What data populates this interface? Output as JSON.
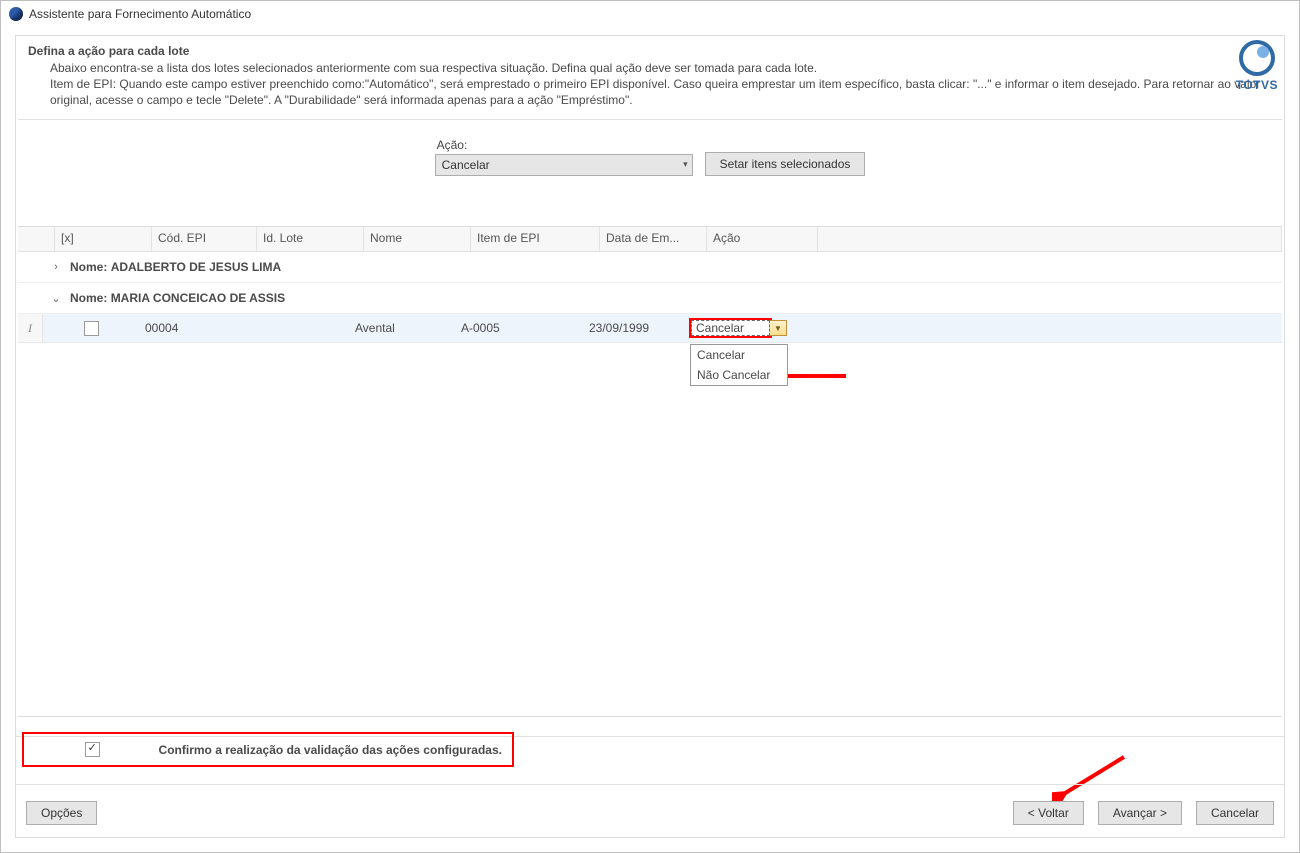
{
  "window": {
    "title": "Assistente para Fornecimento Automático"
  },
  "brand": {
    "name": "TOTVS"
  },
  "page": {
    "title": "Defina a ação para cada lote",
    "desc_line1": "Abaixo encontra-se a lista dos lotes selecionados anteriormente com sua respectiva situação. Defina qual ação deve ser tomada para cada lote.",
    "desc_line2": "Item de EPI: Quando este campo estiver preenchido como:\"Automático\", será emprestado o primeiro EPI disponível. Caso queira emprestar um item específico, basta clicar: \"...\" e informar o item desejado. Para retornar ao valor original, acesse o campo e tecle \"Delete\". A \"Durabilidade\" será informada apenas para a ação \"Empréstimo\"."
  },
  "controls": {
    "action_label": "Ação:",
    "action_value": "Cancelar",
    "set_btn": "Setar itens selecionados"
  },
  "grid": {
    "columns": {
      "chk": "[x]",
      "cod": "Cód. EPI",
      "lote": "Id. Lote",
      "nome": "Nome",
      "item": "Item de EPI",
      "data": "Data de Em...",
      "acao": "Ação"
    },
    "group_prefix": "Nome:",
    "groups": [
      {
        "expanded": false,
        "name": "ADALBERTO DE JESUS LIMA"
      },
      {
        "expanded": true,
        "name": "MARIA CONCEICAO DE ASSIS",
        "rows": [
          {
            "checked": false,
            "cod": "00004",
            "lote": "",
            "nome": "Avental",
            "item": "A-0005",
            "data": "23/09/1999",
            "acao": "Cancelar"
          }
        ]
      }
    ],
    "action_options": [
      "Cancelar",
      "Não Cancelar"
    ]
  },
  "confirm": {
    "checked": true,
    "label": "Confirmo a realização da validação das ações configuradas."
  },
  "footer": {
    "options": "Opções",
    "back": "< Voltar",
    "next": "Avançar >",
    "cancel": "Cancelar"
  }
}
